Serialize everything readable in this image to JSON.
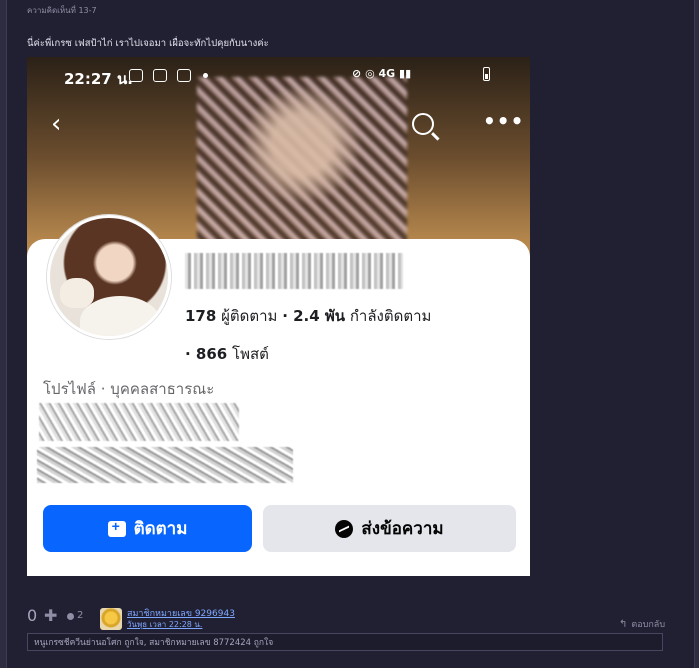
{
  "comment": {
    "label": "ความคิดเห็นที่ 13-7",
    "text": "นี่ค่ะพี่เกรซ เฟสป้าไก่ เราไปเจอมา เผื่อจะทักไปคุยกับนางค่ะ"
  },
  "screenshot": {
    "status": {
      "time": "22:27 น.",
      "network": "4G"
    },
    "profile": {
      "followers_count": "178",
      "followers_label": "ผู้ติดตาม",
      "following_count": "2.4 พัน",
      "following_label": "กำลังติดตาม",
      "posts_count": "866",
      "posts_label": "โพสต์",
      "category": "โปรไฟล์ · บุคคลสาธารณะ"
    },
    "buttons": {
      "follow": "ติดตาม",
      "message": "ส่งข้อความ"
    },
    "colors": {
      "follow_bg": "#0866ff",
      "message_bg": "#e4e6eb"
    }
  },
  "footer": {
    "vote_count": "0",
    "emotion_count": "2",
    "user_name": "สมาชิกหมายเลข 9296943",
    "user_date": "วันพุธ เวลา 22:28 น.",
    "reply": "ตอบกลับ",
    "likes": "หนูเกรซชีควีนย่านอโศก ถูกใจ, สมาชิกหมายเลข 8772424 ถูกใจ"
  }
}
